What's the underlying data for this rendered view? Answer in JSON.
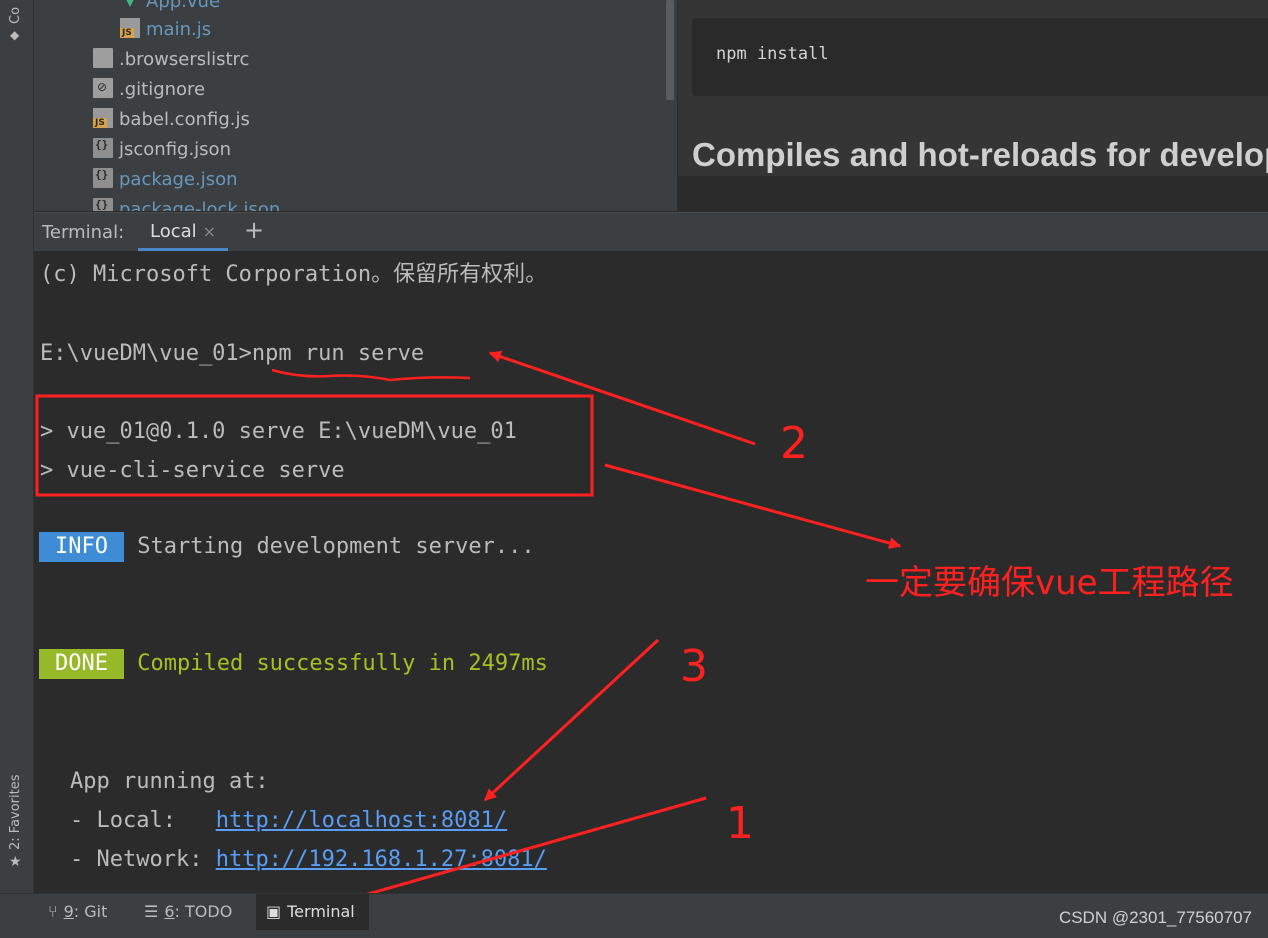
{
  "left_tool_strip": {
    "top_tab_label": "Co",
    "bottom_tab_label": "2: Favorites"
  },
  "project_tree": {
    "items": [
      {
        "name": "App.vue",
        "icon": "vue-file-icon"
      },
      {
        "name": "main.js",
        "icon": "js-file-icon"
      },
      {
        "name": ".browserslistrc",
        "icon": "text-file-icon"
      },
      {
        "name": ".gitignore",
        "icon": "gitignore-file-icon"
      },
      {
        "name": "babel.config.js",
        "icon": "js-file-icon"
      },
      {
        "name": "jsconfig.json",
        "icon": "json-file-icon"
      },
      {
        "name": "package.json",
        "icon": "json-file-icon"
      },
      {
        "name": "package-lock.json",
        "icon": "json-file-icon"
      }
    ]
  },
  "readme_preview": {
    "code": "npm install",
    "heading": "Compiles and hot-reloads for development"
  },
  "terminal_header": {
    "title": "Terminal:",
    "active_tab": "Local",
    "close_glyph": "×",
    "add_glyph": "+"
  },
  "terminal": {
    "line_copyright": "(c) Microsoft Corporation。保留所有权利。",
    "prompt": "E:\\vueDM\\vue_01>",
    "command": "npm run serve",
    "script_line_1": "> vue_01@0.1.0 serve E:\\vueDM\\vue_01",
    "script_line_2": "> vue-cli-service serve",
    "info_badge": "INFO",
    "info_text": "Starting development server...",
    "done_badge": "DONE",
    "done_text": "Compiled successfully in 2497ms",
    "app_running": "App running at:",
    "local_label": "- Local:   ",
    "local_url": "http://localhost:8081/",
    "network_label": "- Network: ",
    "network_url": "http://192.168.1.27:8081/"
  },
  "annotations": {
    "num_1": "1",
    "num_2": "2",
    "num_3": "3",
    "note": "一定要确保vue工程路径",
    "color": "#ff2020"
  },
  "status_bar": {
    "git_number": "9",
    "git_label": ": Git",
    "todo_number": "6",
    "todo_label": ": TODO",
    "terminal_label": "Terminal",
    "watermark": "CSDN @2301_77560707"
  }
}
